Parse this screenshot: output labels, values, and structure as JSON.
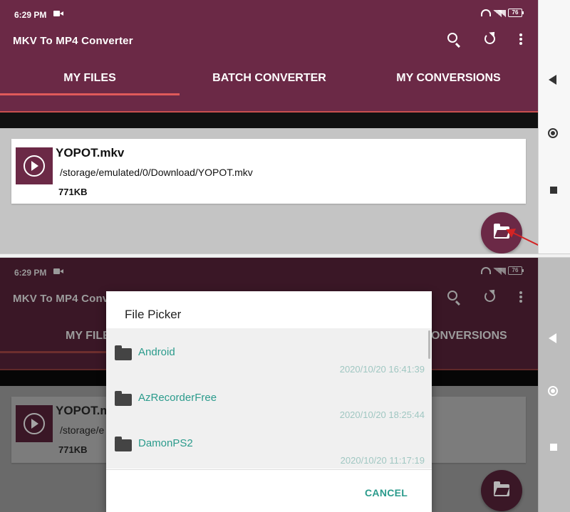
{
  "status": {
    "time": "6:29 PM",
    "battery": "76"
  },
  "app": {
    "title": "MKV To MP4 Converter"
  },
  "tabs": [
    {
      "label": "MY FILES"
    },
    {
      "label": "BATCH CONVERTER"
    },
    {
      "label": "MY CONVERSIONS"
    }
  ],
  "dimmed_tabs": [
    {
      "label": "MY FILE"
    },
    {
      "label": "ONVERSIONS"
    }
  ],
  "dimmed_title": "MKV To MP4 Conver",
  "file": {
    "name": "YOPOT.mkv",
    "path": "/storage/emulated/0/Download/YOPOT.mkv",
    "size": "771KB"
  },
  "dimmed_file": {
    "name": "YOPOT.m",
    "path": "/storage/e",
    "size": "771KB"
  },
  "dialog": {
    "title": "File Picker",
    "items": [
      {
        "name": "Android",
        "date": "2020/10/20 16:41:39"
      },
      {
        "name": "AzRecorderFree",
        "date": "2020/10/20 18:25:44"
      },
      {
        "name": "DamonPS2",
        "date": "2020/10/20 11:17:19"
      }
    ],
    "cancel_label": "CANCEL"
  },
  "colors": {
    "primary": "#6b2946",
    "accent": "#2b9b8c",
    "tab_indicator": "#e05a5a",
    "annotation_arrow": "#d42424"
  },
  "icons": [
    "search-icon",
    "refresh-icon",
    "more-vert-icon",
    "play-circle-icon",
    "folder-open-icon",
    "folder-icon",
    "back-icon",
    "home-icon",
    "recents-icon"
  ]
}
